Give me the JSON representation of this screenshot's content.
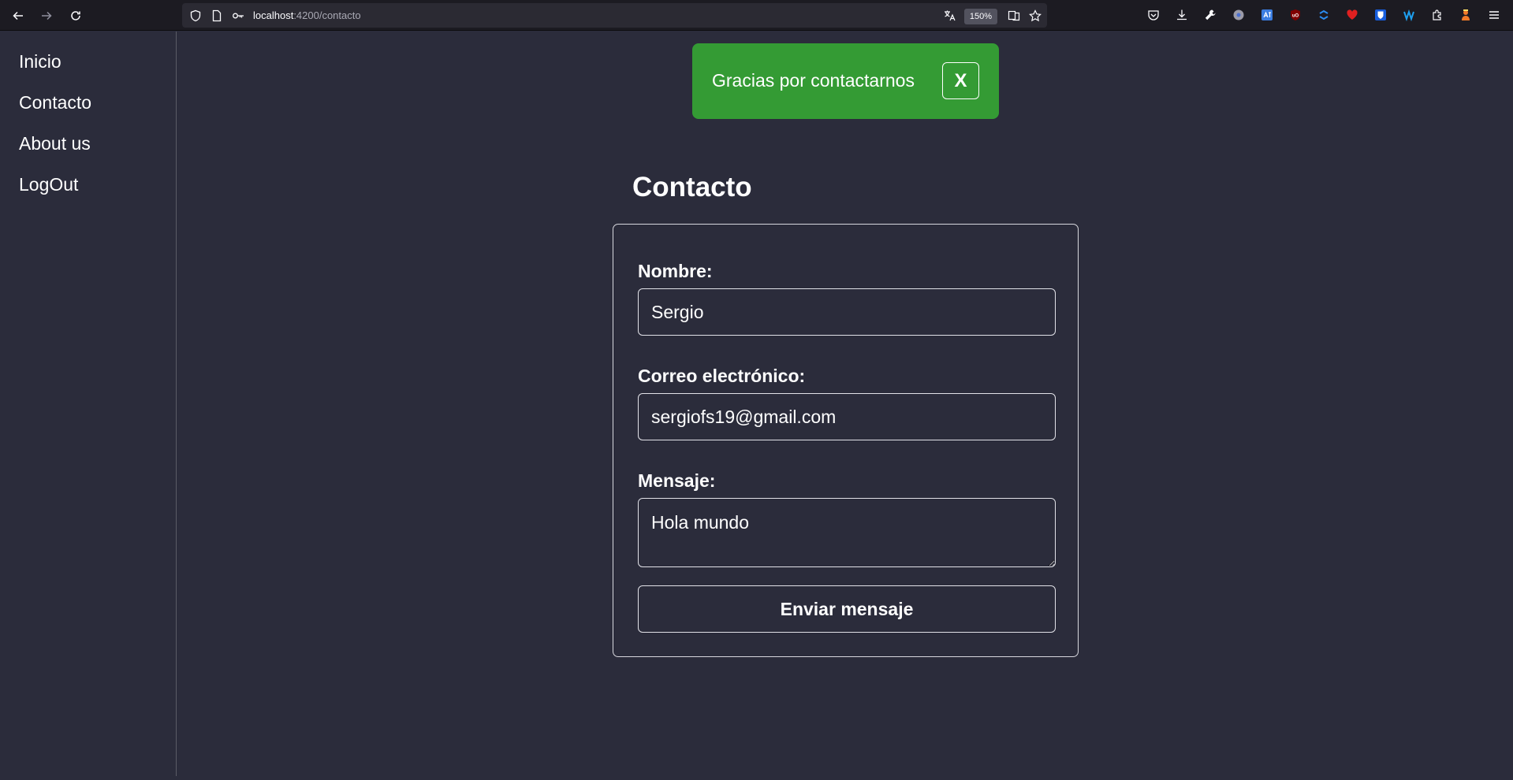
{
  "browser": {
    "url_host": "localhost",
    "url_path": ":4200/contacto",
    "zoom": "150%",
    "icons": [
      "back-arrow-icon",
      "forward-arrow-icon",
      "reload-icon",
      "shield-icon",
      "page-icon",
      "key-icon",
      "translate-icon",
      "reader-icon",
      "star-icon",
      "pocket-icon",
      "download-icon",
      "wrench-icon",
      "extensions-icon",
      "menu-icon"
    ]
  },
  "sidebar": {
    "items": [
      {
        "label": "Inicio"
      },
      {
        "label": "Contacto"
      },
      {
        "label": "About us"
      },
      {
        "label": "LogOut"
      }
    ]
  },
  "toast": {
    "message": "Gracias por contactarnos",
    "close_label": "X",
    "color": "#349b34"
  },
  "contact": {
    "title": "Contacto",
    "name_label": "Nombre:",
    "name_value": "Sergio",
    "email_label": "Correo electrónico:",
    "email_value": "sergiofs19@gmail.com",
    "message_label": "Mensaje:",
    "message_value": "Hola mundo",
    "submit_label": "Enviar mensaje"
  },
  "colors": {
    "background": "#2b2c3b",
    "toolbar": "#1c1b22",
    "text": "#ffffff"
  }
}
